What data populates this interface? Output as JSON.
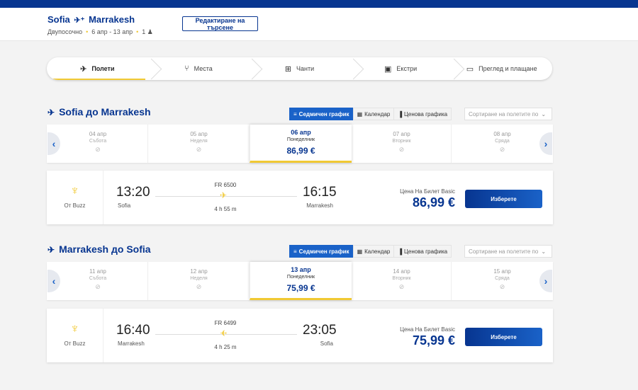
{
  "header": {
    "origin": "Sofia",
    "destination": "Marrakesh",
    "trip_type": "Двупосочно",
    "dates": "6 апр - 13 апр",
    "passengers": "1",
    "edit_label": "Редактиране на търсене"
  },
  "steps": [
    {
      "label": "Полети",
      "icon": "plane-icon",
      "active": true
    },
    {
      "label": "Места",
      "icon": "seat-icon",
      "active": false
    },
    {
      "label": "Чанти",
      "icon": "bag-icon",
      "active": false
    },
    {
      "label": "Екстри",
      "icon": "bus-icon",
      "active": false
    },
    {
      "label": "Преглед и плащане",
      "icon": "card-icon",
      "active": false
    }
  ],
  "view_tabs": {
    "weekly": "Седмичен график",
    "calendar": "Календар",
    "price_chart": "Ценова графика"
  },
  "sort_placeholder": "Сортиране на полетите по",
  "outbound": {
    "title": "Sofia до Marrakesh",
    "dates": [
      {
        "date": "04 апр",
        "weekday": "Събота"
      },
      {
        "date": "05 апр",
        "weekday": "Неделя"
      },
      {
        "date": "06 апр",
        "weekday": "Понеделник",
        "price": "86,99 €",
        "selected": true
      },
      {
        "date": "07 апр",
        "weekday": "Вторник"
      },
      {
        "date": "08 апр",
        "weekday": "Сряда"
      }
    ],
    "flight": {
      "operator": "От Buzz",
      "dep_time": "13:20",
      "dep_city": "Sofia",
      "arr_time": "16:15",
      "arr_city": "Marrakesh",
      "flight_no": "FR 6500",
      "duration": "4 h 55 m",
      "fare_label": "Цена На Билет Basic",
      "price": "86,99 €",
      "select_label": "Изберете"
    }
  },
  "inbound": {
    "title": "Marrakesh до Sofia",
    "dates": [
      {
        "date": "11 апр",
        "weekday": "Събота"
      },
      {
        "date": "12 апр",
        "weekday": "Неделя"
      },
      {
        "date": "13 апр",
        "weekday": "Понеделник",
        "price": "75,99 €",
        "selected": true
      },
      {
        "date": "14 апр",
        "weekday": "Вторник"
      },
      {
        "date": "15 апр",
        "weekday": "Сряда"
      }
    ],
    "flight": {
      "operator": "От Buzz",
      "dep_time": "16:40",
      "dep_city": "Marrakesh",
      "arr_time": "23:05",
      "arr_city": "Sofia",
      "flight_no": "FR 6499",
      "duration": "4 h 25 m",
      "fare_label": "Цена На Билет Basic",
      "price": "75,99 €",
      "select_label": "Изберете"
    }
  },
  "colors": {
    "brand": "#073590",
    "accent": "#f1c933",
    "button": "#1a62c8"
  }
}
